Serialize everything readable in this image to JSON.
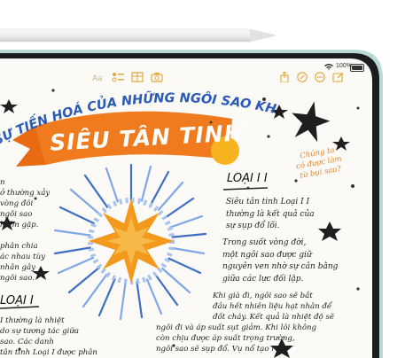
{
  "statusbar": {
    "battery": "100%"
  },
  "toolbar": {
    "left_icons": [
      "text-format-icon",
      "checklist-icon",
      "table-icon",
      "camera-icon"
    ],
    "right_icons": [
      "share-icon",
      "markup-icon",
      "more-icon",
      "compose-icon"
    ]
  },
  "note": {
    "heading": "SỰ TIẾN HOÁ CỦA NHỮNG NGÔI SAO KHỔNG LỒ:",
    "banner": "SIÊU TÂN TINH",
    "side_note": [
      "Chúng ta",
      "có được làm",
      "từ bụi sao?"
    ],
    "section1_title": "LOẠI I I",
    "section1_body": [
      "Siêu tân tinh Loại I I",
      "thường là kết quả của",
      "sự sụp đổ lõi."
    ],
    "section1_para2": [
      "Trong suốt vòng đời,",
      "một ngôi sao được giữ",
      "nguyên ven nhờ sự cân bằng",
      "giữa các lực đối lập."
    ],
    "section1_para3": [
      "Khi già đi, ngôi sao sẽ bắt",
      "đầu hết nhiên liệu hạt nhân để",
      "đốt cháy. Kết quả là nhiệt độ sẽ",
      "ngôi đi và áp suất sụt giảm. Khi lõi không",
      "còn chịu được áp suất trọng trường,",
      "ngôi sao sẽ sụp đổ. Vụ nổ tạo ra"
    ],
    "left_col_top": [
      "n",
      "ở thường xảy",
      "vòng đôi",
      "ngôi sao",
      "hiếm gặp."
    ],
    "left_col_mid": [
      "phân chia",
      "ác nhau tùy",
      "nhân gây",
      "ngôi sao."
    ],
    "section2_title": "LOẠI I",
    "left_col_bottom": [
      "I thường là nhiệt",
      "do sự tương tác giữa",
      "sao. Các danh",
      "tân tinh Loại I được phân"
    ]
  }
}
